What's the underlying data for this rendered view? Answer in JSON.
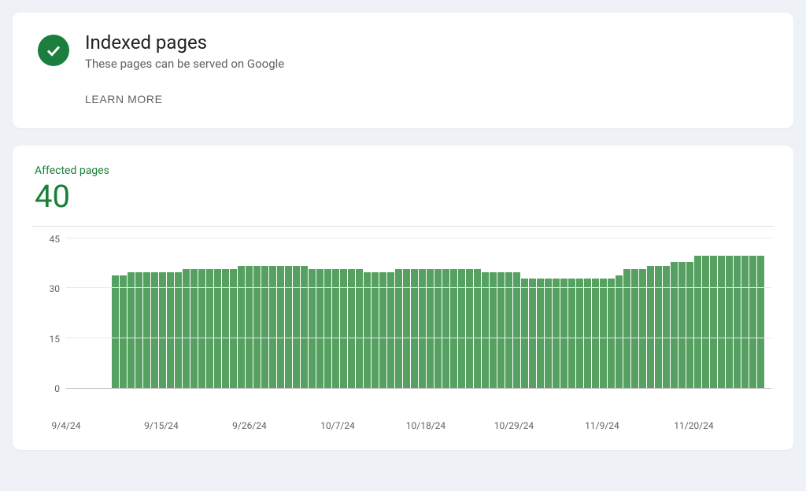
{
  "header": {
    "title": "Indexed pages",
    "subtitle": "These pages can be served on Google",
    "learn_more": "LEARN MORE"
  },
  "metric": {
    "label": "Affected pages",
    "value": "40"
  },
  "chart_data": {
    "type": "bar",
    "title": "",
    "xlabel": "",
    "ylabel": "",
    "ylim": [
      0,
      45
    ],
    "y_ticks": [
      0,
      15,
      30,
      45
    ],
    "categories": [
      "9/7/24",
      "9/8/24",
      "9/9/24",
      "9/10/24",
      "9/11/24",
      "9/12/24",
      "9/13/24",
      "9/14/24",
      "9/15/24",
      "9/16/24",
      "9/17/24",
      "9/18/24",
      "9/19/24",
      "9/20/24",
      "9/21/24",
      "9/22/24",
      "9/23/24",
      "9/24/24",
      "9/25/24",
      "9/26/24",
      "9/27/24",
      "9/28/24",
      "9/29/24",
      "9/30/24",
      "10/1/24",
      "10/2/24",
      "10/3/24",
      "10/4/24",
      "10/5/24",
      "10/6/24",
      "10/7/24",
      "10/8/24",
      "10/9/24",
      "10/10/24",
      "10/11/24",
      "10/12/24",
      "10/13/24",
      "10/14/24",
      "10/15/24",
      "10/16/24",
      "10/17/24",
      "10/18/24",
      "10/19/24",
      "10/20/24",
      "10/21/24",
      "10/22/24",
      "10/23/24",
      "10/24/24",
      "10/25/24",
      "10/26/24",
      "10/27/24",
      "10/28/24",
      "10/29/24",
      "10/30/24",
      "10/31/24",
      "11/1/24",
      "11/2/24",
      "11/3/24",
      "11/4/24",
      "11/5/24",
      "11/6/24",
      "11/7/24",
      "11/8/24",
      "11/9/24",
      "11/10/24",
      "11/11/24",
      "11/12/24",
      "11/13/24",
      "11/14/24",
      "11/15/24",
      "11/16/24",
      "11/17/24",
      "11/18/24",
      "11/19/24",
      "11/20/24",
      "11/21/24",
      "11/22/24",
      "11/23/24",
      "11/24/24",
      "11/25/24",
      "11/26/24",
      "11/27/24",
      "11/28/24"
    ],
    "values": [
      34,
      34,
      35,
      35,
      35,
      35,
      35,
      35,
      35,
      36,
      36,
      36,
      36,
      36,
      36,
      36,
      37,
      37,
      37,
      37,
      37,
      37,
      37,
      37,
      37,
      36,
      36,
      36,
      36,
      36,
      36,
      36,
      35,
      35,
      35,
      35,
      36,
      36,
      36,
      36,
      36,
      36,
      36,
      36,
      36,
      36,
      36,
      35,
      35,
      35,
      35,
      35,
      33,
      33,
      33,
      33,
      33,
      33,
      33,
      33,
      33,
      33,
      33,
      33,
      34,
      36,
      36,
      36,
      37,
      37,
      37,
      38,
      38,
      38,
      40,
      40,
      40,
      40,
      40,
      40,
      40,
      40,
      40
    ],
    "x_tick_labels": [
      "9/4/24",
      "9/15/24",
      "9/26/24",
      "10/7/24",
      "10/18/24",
      "10/29/24",
      "11/9/24",
      "11/20/24"
    ],
    "x_tick_positions_pct": [
      0,
      13.5,
      26,
      38.5,
      51,
      63.5,
      76,
      89
    ]
  }
}
